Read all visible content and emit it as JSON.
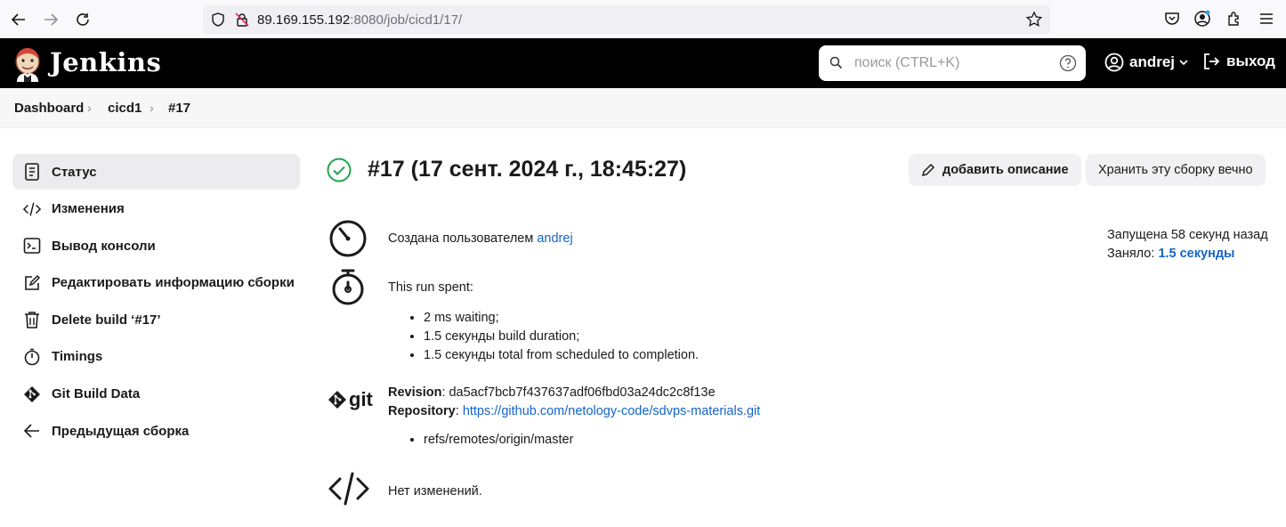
{
  "browser": {
    "url_host": "89.169.155.192",
    "url_rest": ":8080/job/cicd1/17/"
  },
  "header": {
    "app_title": "Jenkins",
    "search_placeholder": "поиск (CTRL+K)",
    "user_name": "andrej",
    "logout_label": "выход"
  },
  "breadcrumb": {
    "items": [
      "Dashboard",
      "cicd1",
      "#17"
    ]
  },
  "sidebar": {
    "items": [
      {
        "label": "Статус",
        "icon": "document-icon"
      },
      {
        "label": "Изменения",
        "icon": "code-icon"
      },
      {
        "label": "Вывод консоли",
        "icon": "terminal-icon"
      },
      {
        "label": "Редактировать информацию сборки",
        "icon": "edit-icon"
      },
      {
        "label": "Delete build ‘#17’",
        "icon": "trash-icon"
      },
      {
        "label": "Timings",
        "icon": "stopwatch-icon"
      },
      {
        "label": "Git Build Data",
        "icon": "git-icon"
      },
      {
        "label": "Предыдущая сборка",
        "icon": "arrow-left-icon"
      }
    ]
  },
  "main": {
    "title": "#17 (17 сент. 2024 г., 18:45:27)",
    "add_description_label": "добавить описание",
    "keep_forever_label": "Хранить эту сборку вечно",
    "started_by_prefix": "Создана пользователем ",
    "started_by_user": "andrej",
    "started_ago": "Запущена 58 секунд назад",
    "took_prefix": "Заняло: ",
    "took_value": "1.5 секунды",
    "run_spent_label": "This run spent:",
    "run_spent_items": [
      "2 ms waiting;",
      "1.5 секунды build duration;",
      "1.5 секунды total from scheduled to completion."
    ],
    "revision_label": "Revision",
    "revision_value": ": da5acf7bcb7f437637adf06fbd03a24dc2c8f13e",
    "repository_label": "Repository",
    "repository_sep": ": ",
    "repository_url": "https://github.com/netology-code/sdvps-materials.git",
    "refs": [
      "refs/remotes/origin/master"
    ],
    "git_label": "git",
    "no_changes": "Нет изменений."
  },
  "colors": {
    "success": "#1ea64b",
    "link": "#1464c8",
    "header_bg": "#000000"
  }
}
